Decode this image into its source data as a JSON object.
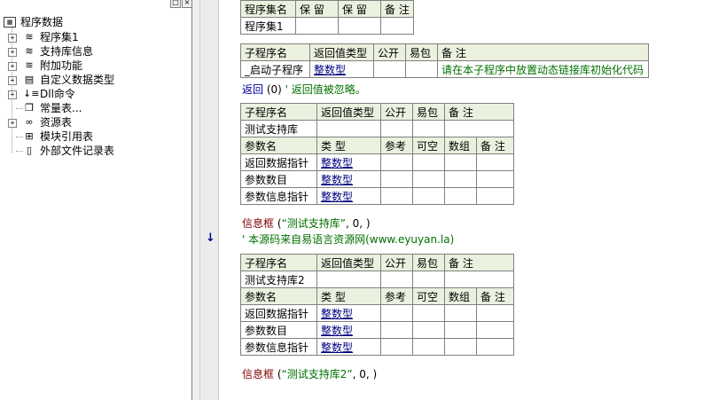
{
  "tree": {
    "root": "程序数据",
    "items": [
      {
        "label": "程序集1",
        "icon": "program-set-icon"
      },
      {
        "label": "支持库信息",
        "icon": "library-info-icon"
      },
      {
        "label": "附加功能",
        "icon": "addon-icon"
      },
      {
        "label": "自定义数据类型",
        "icon": "custom-type-icon"
      },
      {
        "label": "Dll命令",
        "icon": "dll-command-icon"
      },
      {
        "label": "常量表...",
        "icon": "constant-table-icon"
      },
      {
        "label": "资源表",
        "icon": "resource-table-icon"
      },
      {
        "label": "模块引用表",
        "icon": "module-ref-icon"
      },
      {
        "label": "外部文件记录表",
        "icon": "external-file-icon"
      }
    ]
  },
  "assembly": {
    "headers": [
      "程序集名",
      "保 留",
      "保 留",
      "备 注"
    ],
    "row": [
      "程序集1",
      "",
      "",
      ""
    ]
  },
  "sub1": {
    "headers": [
      "子程序名",
      "返回值类型",
      "公开",
      "易包",
      "备 注"
    ],
    "row": {
      "name": "_启动子程序",
      "type": "整数型",
      "pub": "",
      "easy": "",
      "note": "请在本子程序中放置动态链接库初始化代码"
    }
  },
  "line1": {
    "kw": "返回",
    "rest": " (0) ",
    "comment": "' 返回值被忽略。"
  },
  "sub2": {
    "headers": [
      "子程序名",
      "返回值类型",
      "公开",
      "易包",
      "备 注"
    ],
    "name": "测试支持库",
    "param_headers": [
      "参数名",
      "类 型",
      "参考",
      "可空",
      "数组",
      "备 注"
    ],
    "params": [
      {
        "name": "返回数据指针",
        "type": "整数型"
      },
      {
        "name": "参数数目",
        "type": "整数型"
      },
      {
        "name": "参数信息指针",
        "type": "整数型"
      }
    ]
  },
  "line2": {
    "kw": "信息框",
    "open": " (",
    "str": "“测试支持库”",
    "rest": ", 0, )"
  },
  "line3": {
    "comment": "' 本源码来自易语言资源网(www.eyuyan.la)"
  },
  "sub3": {
    "headers": [
      "子程序名",
      "返回值类型",
      "公开",
      "易包",
      "备 注"
    ],
    "name": "测试支持库2",
    "param_headers": [
      "参数名",
      "类 型",
      "参考",
      "可空",
      "数组",
      "备 注"
    ],
    "params": [
      {
        "name": "返回数据指针",
        "type": "整数型"
      },
      {
        "name": "参数数目",
        "type": "整数型"
      },
      {
        "name": "参数信息指针",
        "type": "整数型"
      }
    ]
  },
  "line4": {
    "kw": "信息框",
    "open": " (",
    "str": "“测试支持库2”",
    "rest": ", 0, )"
  },
  "colors": {
    "header_bg": "#ebf1df",
    "link": "#000080",
    "comment": "#007000",
    "keyword": "#800000"
  }
}
